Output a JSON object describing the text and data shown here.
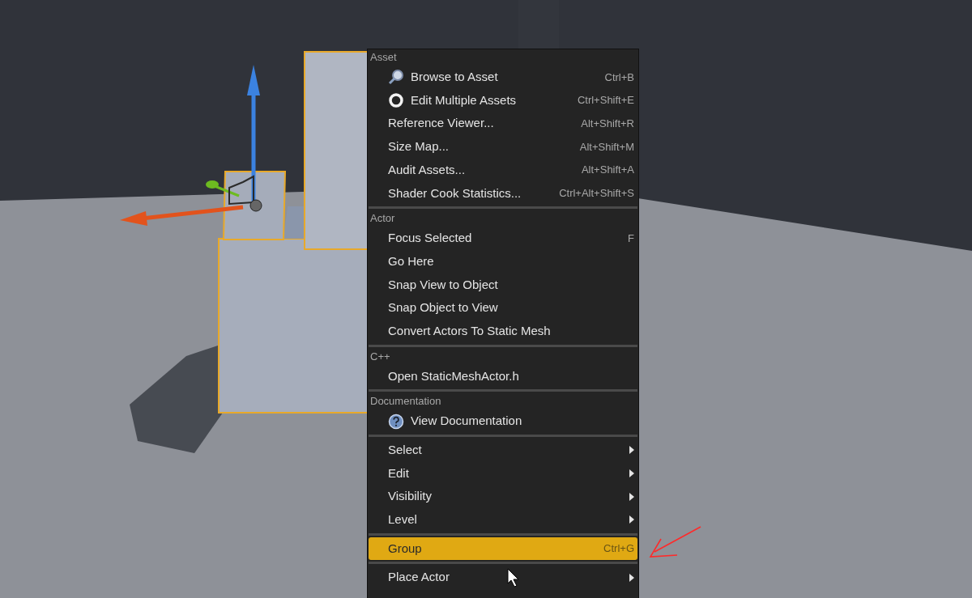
{
  "context_menu": {
    "sections": [
      {
        "header": "Asset",
        "items": [
          {
            "kind": "browse",
            "label": "Browse to Asset",
            "shortcut": "Ctrl+B",
            "selected": false
          },
          {
            "kind": "multiedit",
            "label": "Edit Multiple Assets",
            "shortcut": "Ctrl+Shift+E",
            "selected": false
          },
          {
            "kind": "command",
            "label": "Reference Viewer...",
            "shortcut": "Alt+Shift+R",
            "selected": false
          },
          {
            "kind": "command",
            "label": "Size Map...",
            "shortcut": "Alt+Shift+M",
            "selected": false
          },
          {
            "kind": "command",
            "label": "Audit Assets...",
            "shortcut": "Alt+Shift+A",
            "selected": false
          },
          {
            "kind": "command",
            "label": "Shader Cook Statistics...",
            "shortcut": "Ctrl+Alt+Shift+S",
            "selected": false
          }
        ]
      },
      {
        "header": "Actor",
        "items": [
          {
            "kind": "command",
            "label": "Focus Selected",
            "shortcut": "F",
            "selected": false
          },
          {
            "kind": "command",
            "label": "Go Here",
            "selected": false
          },
          {
            "kind": "command",
            "label": "Snap View to Object",
            "selected": false
          },
          {
            "kind": "command",
            "label": "Snap Object to View",
            "selected": false
          },
          {
            "kind": "command",
            "label": "Convert Actors To Static Mesh",
            "selected": false
          }
        ]
      },
      {
        "header": "C++",
        "items": [
          {
            "kind": "command",
            "label": "Open StaticMeshActor.h",
            "selected": false
          }
        ]
      },
      {
        "header": "Documentation",
        "items": [
          {
            "kind": "help",
            "label": "View Documentation",
            "selected": false
          }
        ]
      },
      {
        "items": [
          {
            "kind": "submenu",
            "label": "Select",
            "selected": false
          },
          {
            "kind": "submenu",
            "label": "Edit",
            "selected": false
          },
          {
            "kind": "submenu",
            "label": "Visibility",
            "selected": false
          },
          {
            "kind": "submenu",
            "label": "Level",
            "selected": false
          }
        ]
      },
      {
        "items": [
          {
            "kind": "command",
            "label": "Group",
            "shortcut": "Ctrl+G",
            "selected": true
          }
        ]
      },
      {
        "items": [
          {
            "kind": "submenu",
            "label": "Place Actor",
            "selected": false
          }
        ]
      }
    ]
  }
}
